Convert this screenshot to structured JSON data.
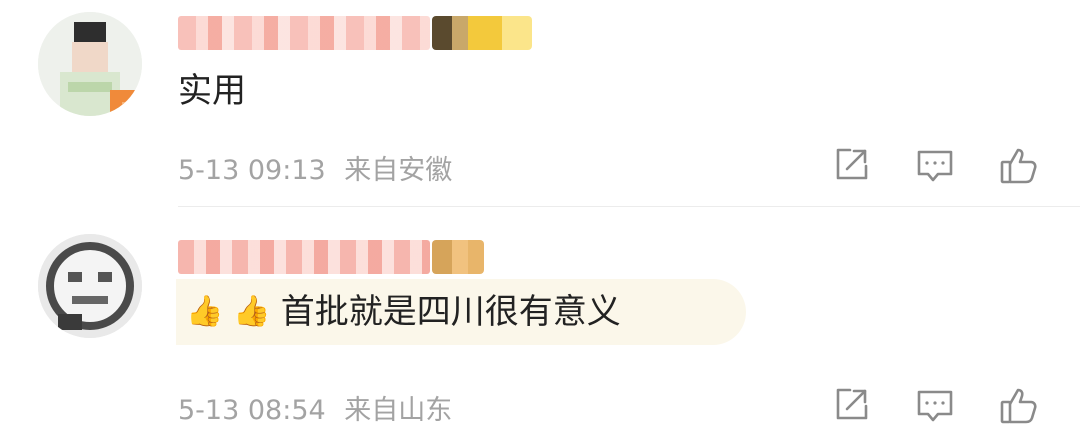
{
  "comments": [
    {
      "text": "实用",
      "time": "5-13 09:13",
      "location": "来自安徽"
    },
    {
      "emoji": "👍",
      "text": "首批就是四川很有意义",
      "time": "5-13 08:54",
      "location": "来自山东"
    }
  ],
  "colors": {
    "meta": "#a3a3a3",
    "bubble": "#fbf7ea",
    "text": "#222222"
  },
  "icons": [
    "share-icon",
    "comment-icon",
    "like-icon"
  ]
}
